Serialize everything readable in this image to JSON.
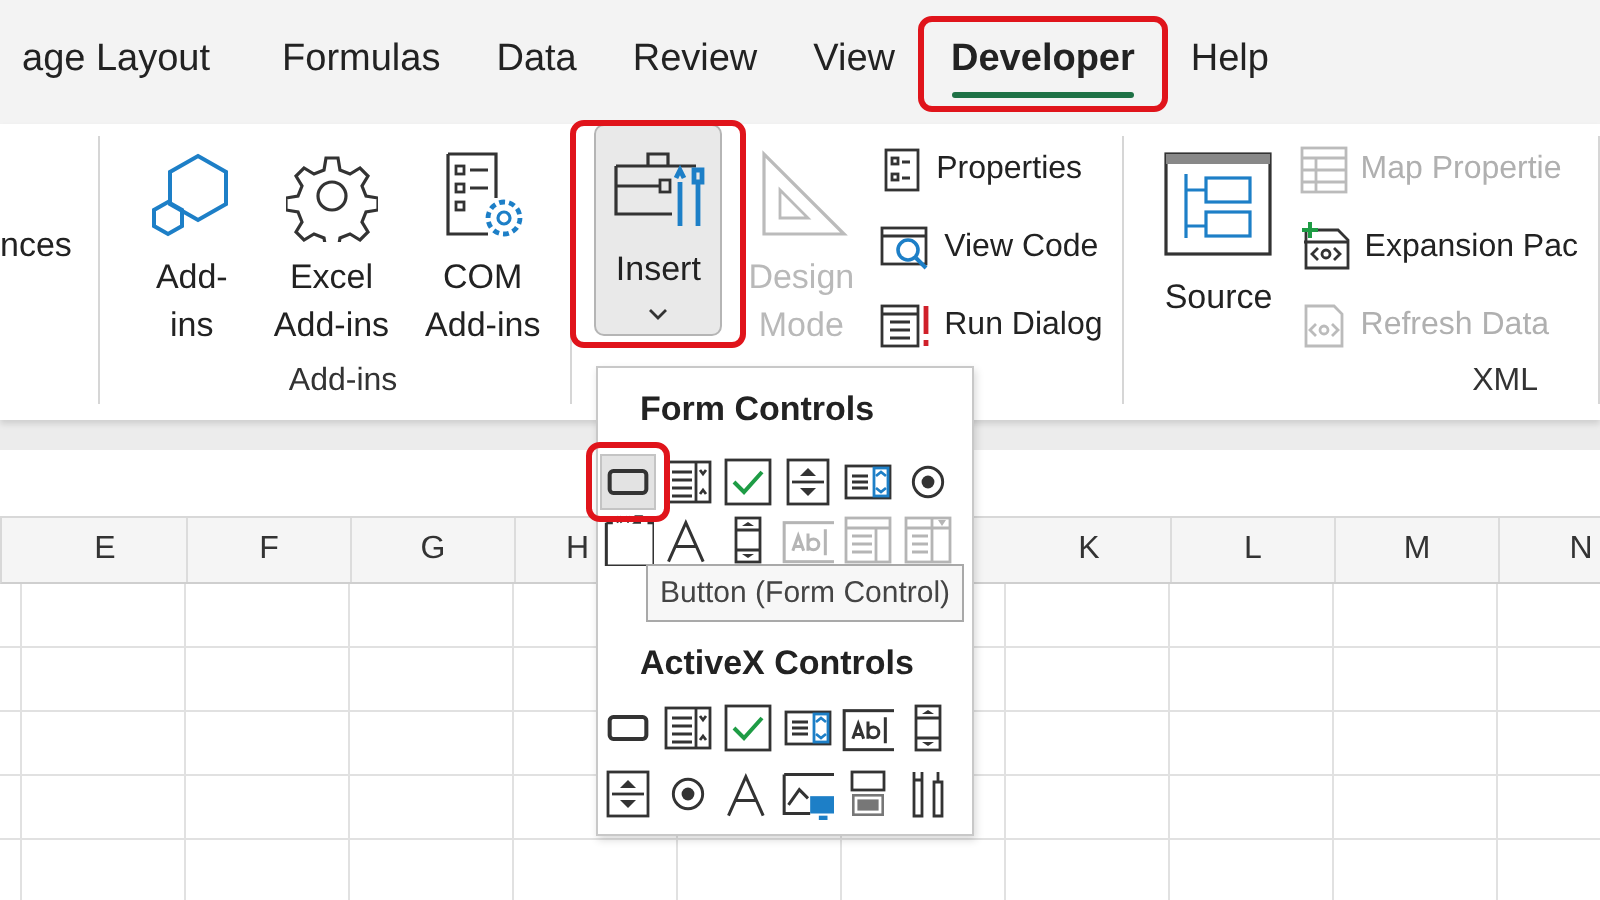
{
  "tabs": [
    {
      "label": "age Layout",
      "selected": false,
      "annotated": false
    },
    {
      "label": "Formulas",
      "selected": false,
      "annotated": false
    },
    {
      "label": "Data",
      "selected": false,
      "annotated": false
    },
    {
      "label": "Review",
      "selected": false,
      "annotated": false
    },
    {
      "label": "View",
      "selected": false,
      "annotated": false
    },
    {
      "label": "Developer",
      "selected": true,
      "annotated": true
    },
    {
      "label": "Help",
      "selected": false,
      "annotated": false
    }
  ],
  "ribbon": {
    "cut_group_text": "nces",
    "groups": [
      {
        "label": "Add-ins",
        "items": [
          {
            "kind": "hexagons",
            "lines": [
              "Add-",
              "ins"
            ],
            "disabled": false
          },
          {
            "kind": "gear",
            "lines": [
              "Excel",
              "Add-ins"
            ],
            "disabled": false
          },
          {
            "kind": "com",
            "lines": [
              "COM",
              "Add-ins"
            ],
            "disabled": false
          }
        ]
      },
      {
        "items": [
          {
            "kind": "toolbox",
            "lines": [
              "Insert"
            ],
            "disabled": false,
            "pressed": true,
            "annotated": true
          },
          {
            "kind": "set-square",
            "lines": [
              "Design",
              "Mode"
            ],
            "disabled": true
          },
          {
            "kind": "stack",
            "items": [
              {
                "kind": "properties",
                "label": "Properties",
                "disabled": false
              },
              {
                "kind": "view-code",
                "label": "View Code",
                "disabled": false
              },
              {
                "kind": "run-dialog",
                "label": "Run Dialog",
                "disabled": false
              }
            ]
          }
        ]
      },
      {
        "label": "XML",
        "items": [
          {
            "kind": "source",
            "lines": [
              "Source"
            ],
            "disabled": false
          },
          {
            "kind": "stack",
            "items": [
              {
                "kind": "map-properties",
                "label": "Map Propertie",
                "disabled": true
              },
              {
                "kind": "expansion",
                "label": "Expansion Pac",
                "disabled": false
              },
              {
                "kind": "refresh",
                "label": "Refresh Data",
                "disabled": true
              }
            ]
          }
        ]
      }
    ]
  },
  "insert_menu": {
    "sections": [
      {
        "title": "Form Controls",
        "controls": [
          {
            "kind": "button",
            "disabled": false,
            "selected": true,
            "annotated": true
          },
          {
            "kind": "combo",
            "disabled": false,
            "selected": false,
            "annotated": false
          },
          {
            "kind": "checkbox",
            "disabled": false,
            "selected": false,
            "annotated": false
          },
          {
            "kind": "spin",
            "disabled": false,
            "selected": false,
            "annotated": false
          },
          {
            "kind": "listbox",
            "disabled": false,
            "selected": false,
            "annotated": false
          },
          {
            "kind": "option",
            "disabled": false,
            "selected": false,
            "annotated": false
          },
          {
            "kind": "group",
            "disabled": false,
            "selected": false,
            "annotated": false
          },
          {
            "kind": "label",
            "disabled": false,
            "selected": false,
            "annotated": false
          },
          {
            "kind": "scrollbar",
            "disabled": false,
            "selected": false,
            "annotated": false
          },
          {
            "kind": "textbox",
            "disabled": true,
            "selected": false,
            "annotated": false
          },
          {
            "kind": "combo-list",
            "disabled": true,
            "selected": false,
            "annotated": false
          },
          {
            "kind": "combo-drop",
            "disabled": true,
            "selected": false,
            "annotated": false
          }
        ]
      },
      {
        "title": "ActiveX Controls",
        "controls": [
          {
            "kind": "button",
            "disabled": false,
            "selected": false,
            "annotated": false
          },
          {
            "kind": "combo",
            "disabled": false,
            "selected": false,
            "annotated": false
          },
          {
            "kind": "checkbox",
            "disabled": false,
            "selected": false,
            "annotated": false
          },
          {
            "kind": "listbox",
            "disabled": false,
            "selected": false,
            "annotated": false
          },
          {
            "kind": "textbox",
            "disabled": false,
            "selected": false,
            "annotated": false
          },
          {
            "kind": "scrollbar",
            "disabled": false,
            "selected": false,
            "annotated": false
          },
          {
            "kind": "spin",
            "disabled": false,
            "selected": false,
            "annotated": false
          },
          {
            "kind": "option",
            "disabled": false,
            "selected": false,
            "annotated": false
          },
          {
            "kind": "label",
            "disabled": false,
            "selected": false,
            "annotated": false
          },
          {
            "kind": "image",
            "disabled": false,
            "selected": false,
            "annotated": false
          },
          {
            "kind": "toggle",
            "disabled": false,
            "selected": false,
            "annotated": false
          },
          {
            "kind": "more",
            "disabled": false,
            "selected": false,
            "annotated": false
          }
        ]
      }
    ],
    "tooltip": "Button (Form Control)"
  },
  "column_headers": {
    "left": [
      "E",
      "F",
      "G",
      "H"
    ],
    "right": [
      "K",
      "L",
      "M",
      "N"
    ]
  }
}
